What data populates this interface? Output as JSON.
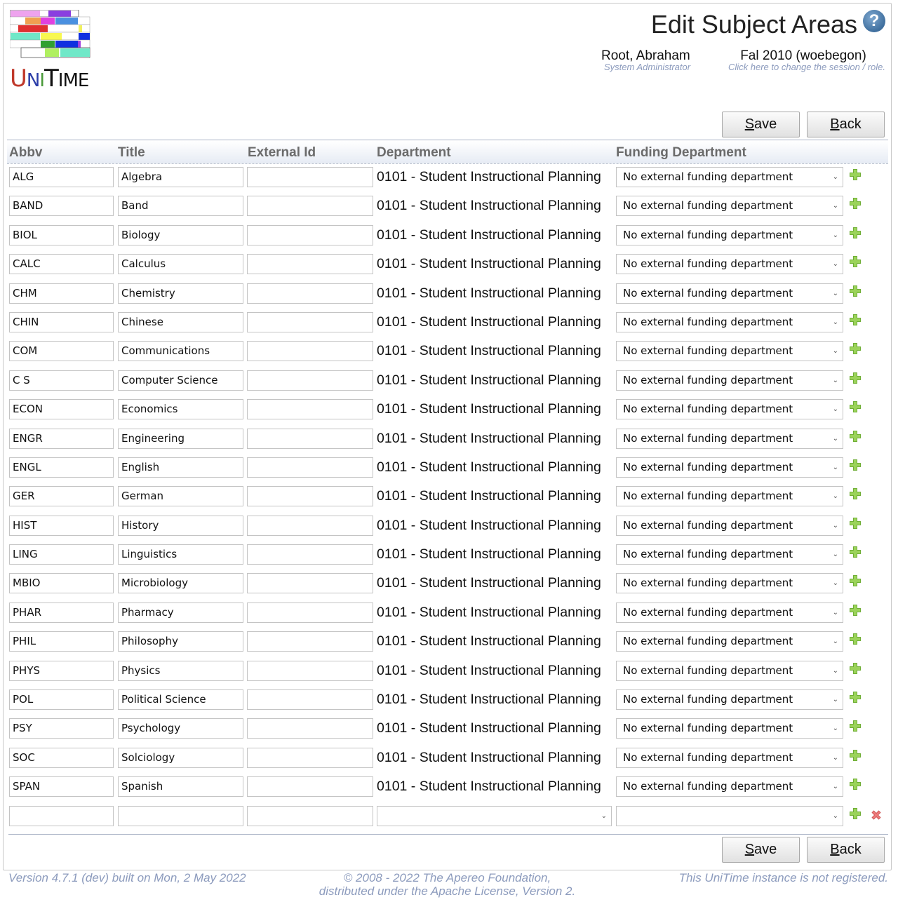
{
  "header": {
    "logo_text": {
      "u": "U",
      "n": "N",
      "i": "I",
      "t": "T",
      "rest": "IME"
    },
    "title": "Edit Subject Areas",
    "help_icon": "question-circle-icon",
    "user": {
      "name": "Root, Abraham",
      "role": "System Administrator"
    },
    "session": {
      "name": "Fal 2010 (woebegon)",
      "hint": "Click here to change the session / role."
    }
  },
  "toolbar": {
    "save_label_prefix": "S",
    "save_label_rest": "ave",
    "back_label_prefix": "B",
    "back_label_rest": "ack"
  },
  "table": {
    "columns": [
      "Abbv",
      "Title",
      "External Id",
      "Department",
      "Funding Department"
    ],
    "rows": [
      {
        "abbv": "ALG",
        "title": "Algebra",
        "external_id": "",
        "department": "0101 - Student Instructional Planning",
        "funding": "No external funding department"
      },
      {
        "abbv": "BAND",
        "title": "Band",
        "external_id": "",
        "department": "0101 - Student Instructional Planning",
        "funding": "No external funding department"
      },
      {
        "abbv": "BIOL",
        "title": "Biology",
        "external_id": "",
        "department": "0101 - Student Instructional Planning",
        "funding": "No external funding department"
      },
      {
        "abbv": "CALC",
        "title": "Calculus",
        "external_id": "",
        "department": "0101 - Student Instructional Planning",
        "funding": "No external funding department"
      },
      {
        "abbv": "CHM",
        "title": "Chemistry",
        "external_id": "",
        "department": "0101 - Student Instructional Planning",
        "funding": "No external funding department"
      },
      {
        "abbv": "CHIN",
        "title": "Chinese",
        "external_id": "",
        "department": "0101 - Student Instructional Planning",
        "funding": "No external funding department"
      },
      {
        "abbv": "COM",
        "title": "Communications",
        "external_id": "",
        "department": "0101 - Student Instructional Planning",
        "funding": "No external funding department"
      },
      {
        "abbv": "C S",
        "title": "Computer Science",
        "external_id": "",
        "department": "0101 - Student Instructional Planning",
        "funding": "No external funding department"
      },
      {
        "abbv": "ECON",
        "title": "Economics",
        "external_id": "",
        "department": "0101 - Student Instructional Planning",
        "funding": "No external funding department"
      },
      {
        "abbv": "ENGR",
        "title": "Engineering",
        "external_id": "",
        "department": "0101 - Student Instructional Planning",
        "funding": "No external funding department"
      },
      {
        "abbv": "ENGL",
        "title": "English",
        "external_id": "",
        "department": "0101 - Student Instructional Planning",
        "funding": "No external funding department"
      },
      {
        "abbv": "GER",
        "title": "German",
        "external_id": "",
        "department": "0101 - Student Instructional Planning",
        "funding": "No external funding department"
      },
      {
        "abbv": "HIST",
        "title": "History",
        "external_id": "",
        "department": "0101 - Student Instructional Planning",
        "funding": "No external funding department"
      },
      {
        "abbv": "LING",
        "title": "Linguistics",
        "external_id": "",
        "department": "0101 - Student Instructional Planning",
        "funding": "No external funding department"
      },
      {
        "abbv": "MBIO",
        "title": "Microbiology",
        "external_id": "",
        "department": "0101 - Student Instructional Planning",
        "funding": "No external funding department"
      },
      {
        "abbv": "PHAR",
        "title": "Pharmacy",
        "external_id": "",
        "department": "0101 - Student Instructional Planning",
        "funding": "No external funding department"
      },
      {
        "abbv": "PHIL",
        "title": "Philosophy",
        "external_id": "",
        "department": "0101 - Student Instructional Planning",
        "funding": "No external funding department"
      },
      {
        "abbv": "PHYS",
        "title": "Physics",
        "external_id": "",
        "department": "0101 - Student Instructional Planning",
        "funding": "No external funding department"
      },
      {
        "abbv": "POL",
        "title": "Political Science",
        "external_id": "",
        "department": "0101 - Student Instructional Planning",
        "funding": "No external funding department"
      },
      {
        "abbv": "PSY",
        "title": "Psychology",
        "external_id": "",
        "department": "0101 - Student Instructional Planning",
        "funding": "No external funding department"
      },
      {
        "abbv": "SOC",
        "title": "Solciology",
        "external_id": "",
        "department": "0101 - Student Instructional Planning",
        "funding": "No external funding department"
      },
      {
        "abbv": "SPAN",
        "title": "Spanish",
        "external_id": "",
        "department": "0101 - Student Instructional Planning",
        "funding": "No external funding department"
      }
    ],
    "new_row": {
      "abbv": "",
      "title": "",
      "external_id": "",
      "department": "",
      "funding": ""
    },
    "icons": {
      "add": "add-row-icon",
      "delete": "delete-row-icon"
    }
  },
  "colors": {
    "accent_green": "#8cc63f",
    "delete_red": "#e05a5a",
    "muted_text": "#8c9bbd",
    "header_text": "#6b6b6b"
  },
  "footer": {
    "version": "Version 4.7.1 (dev) built on Mon, 2 May 2022",
    "copyright_line1": "© 2008 - 2022 The Apereo Foundation,",
    "copyright_line2": "distributed under the Apache License, Version 2.",
    "registration": "This UniTime instance is not registered."
  }
}
